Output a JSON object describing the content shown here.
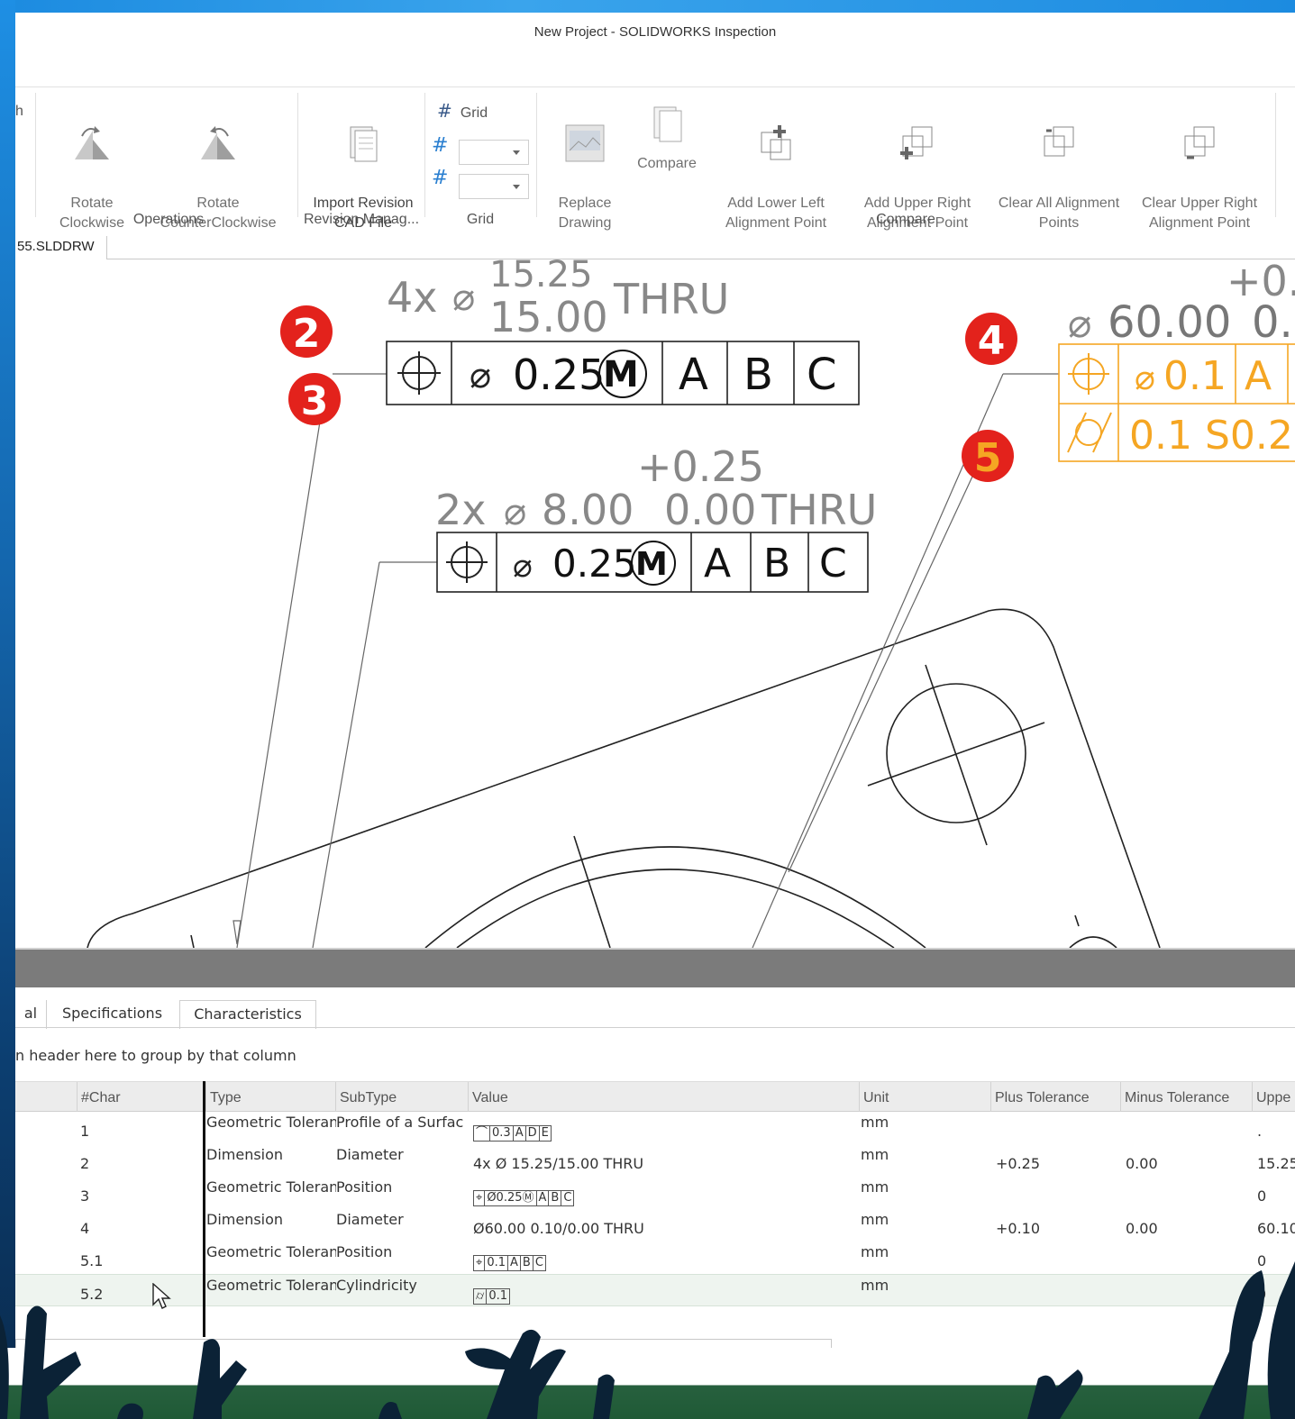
{
  "window": {
    "title": "New Project - SOLIDWORKS Inspection"
  },
  "ribbon": {
    "clipped_left_label": "h",
    "rotate_cw": "Rotate\nClockwise",
    "rotate_ccw": "Rotate\nCounterClockwise",
    "group_operations": "Operations",
    "import_revision": "Import Revision\nCAD File",
    "group_revision": "Revision Manag...",
    "grid_label": "Grid",
    "group_grid": "Grid",
    "replace_drawing": "Replace\nDrawing",
    "compare": "Compare",
    "add_lower_left": "Add Lower Left\nAlignment Point",
    "add_upper_right": "Add Upper Right\nAlignment Point",
    "clear_all": "Clear All Alignment\nPoints",
    "clear_upper_right": "Clear Upper Right\nAlignment Point",
    "group_compare": "Compare"
  },
  "document": {
    "tab": "55.SLDDRW"
  },
  "drawing": {
    "balloons": [
      "2",
      "3",
      "4",
      "5"
    ],
    "balloon_color": "#e3221c",
    "highlight_color": "#f5a623",
    "dim1_count": "4x",
    "dim1_upper": "15.25",
    "dim1_lower": "15.00",
    "dim1_suffix": "THRU",
    "fcf1": [
      "0.25",
      "M",
      "A",
      "B",
      "C"
    ],
    "dim2_tol": "+0.25",
    "dim2_count": "2x",
    "dim2_value": "8.00",
    "dim2_lower": "0.00",
    "dim2_suffix": "THRU",
    "fcf2": [
      "0.25",
      "M",
      "A",
      "B",
      "C"
    ],
    "dim4_tol": "+0.",
    "dim4_value": "60.00",
    "dim4_rest": "0.",
    "fcf4_row1": [
      "0.1",
      "A"
    ],
    "fcf4_row2": "0.1 S0.25"
  },
  "panel": {
    "tabs": [
      "al",
      "Specifications",
      "Characteristics"
    ],
    "active_tab": "Characteristics",
    "group_hint": "n header here to group by that column",
    "columns": [
      "#Char",
      "Type",
      "SubType",
      "Value",
      "Unit",
      "Plus Tolerance",
      "Minus Tolerance",
      "Uppe"
    ],
    "rows": [
      {
        "char": "1",
        "type": "Geometric Toleran",
        "subtype": "Profile of a Surfac",
        "value_fcf": [
          "⌒",
          "0.3",
          "A",
          "D",
          "E"
        ],
        "value": "",
        "unit": "mm",
        "plus": "",
        "minus": "",
        "upper": "."
      },
      {
        "char": "2",
        "type": "Dimension",
        "subtype": "Diameter",
        "value_fcf": [],
        "value": "4x Ø 15.25/15.00 THRU",
        "unit": "mm",
        "plus": "+0.25",
        "minus": "0.00",
        "upper": "15.25"
      },
      {
        "char": "3",
        "type": "Geometric Toleran",
        "subtype": "Position",
        "value_fcf": [
          "⌖",
          "Ø0.25Ⓜ",
          "A",
          "B",
          "C"
        ],
        "value": "",
        "unit": "mm",
        "plus": "",
        "minus": "",
        "upper": "0"
      },
      {
        "char": "4",
        "type": "Dimension",
        "subtype": "Diameter",
        "value_fcf": [],
        "value": "Ø60.00 0.10/0.00 THRU",
        "unit": "mm",
        "plus": "+0.10",
        "minus": "0.00",
        "upper": "60.10"
      },
      {
        "char": "5.1",
        "type": "Geometric Toleran",
        "subtype": "Position",
        "value_fcf": [
          "⌖",
          "0.1",
          "A",
          "B",
          "C"
        ],
        "value": "",
        "unit": "mm",
        "plus": "",
        "minus": "",
        "upper": "0"
      },
      {
        "char": "5.2",
        "type": "Geometric Toleran",
        "subtype": "Cylindricity",
        "value_fcf": [
          "⌭",
          "0.1"
        ],
        "value": "",
        "unit": "mm",
        "plus": "",
        "minus": "",
        "upper": "0"
      }
    ],
    "selected_row": "5.2"
  }
}
